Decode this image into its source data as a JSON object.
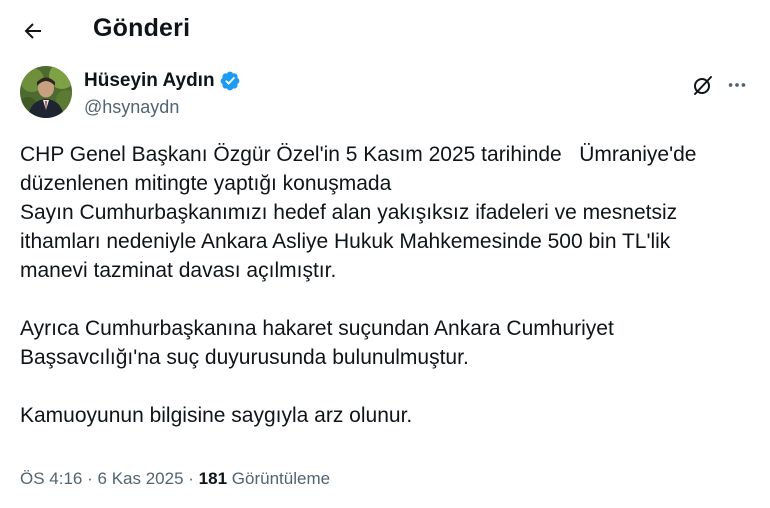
{
  "header": {
    "title": "Gönderi"
  },
  "author": {
    "name": "Hüseyin Aydın",
    "handle": "@hsynaydn"
  },
  "tweet": {
    "paragraphs": [
      [
        "CHP Genel Başkanı Özgür Özel'in 5 Kasım 2025 tarihinde   Ümraniye'de",
        "düzenlenen mitingte yaptığı konuşmada",
        "Sayın Cumhurbaşkanımızı hedef alan yakışıksız ifadeleri ve mesnetsiz",
        "ithamları nedeniyle Ankara Asliye Hukuk Mahkemesinde 500 bin TL'lik",
        "manevi tazminat davası açılmıştır."
      ],
      [
        "Ayrıca Cumhurbaşkanına hakaret suçundan Ankara Cumhuriyet",
        "Başsavcılığı'na suç duyurusunda bulunulmuştur."
      ],
      [
        "Kamuoyunun bilgisine saygıyla arz olunur."
      ]
    ]
  },
  "meta": {
    "time": "ÖS 4:16",
    "separator": "·",
    "date": "6 Kas 2025",
    "views_count": "181",
    "views_label": "Görüntüleme"
  },
  "colors": {
    "text": "#0f1419",
    "secondary": "#536471",
    "verified": "#1d9bf0"
  },
  "icons": {
    "back": "arrow-left-icon",
    "verified": "verified-badge-icon",
    "grok": "grok-icon",
    "more": "more-horizontal-icon"
  }
}
